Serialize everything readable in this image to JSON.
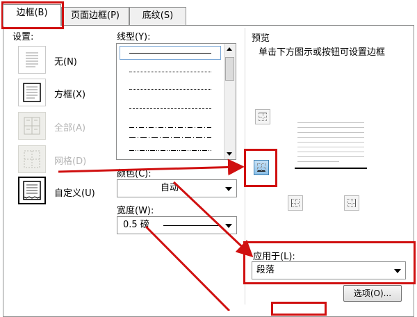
{
  "tabs": [
    {
      "label": "边框(B)"
    },
    {
      "label": "页面边框(P)"
    },
    {
      "label": "底纹(S)"
    }
  ],
  "settings": {
    "title": "设置:",
    "items": [
      {
        "label": "无(N)",
        "enabled": true,
        "selected": false
      },
      {
        "label": "方框(X)",
        "enabled": true,
        "selected": false
      },
      {
        "label": "全部(A)",
        "enabled": false,
        "selected": false
      },
      {
        "label": "网格(D)",
        "enabled": false,
        "selected": false
      },
      {
        "label": "自定义(U)",
        "enabled": true,
        "selected": true
      }
    ]
  },
  "style": {
    "title": "线型(Y):",
    "line_styles": [
      "solid",
      "dotted-fine",
      "dotted",
      "dashed",
      "dash-dot",
      "long-dash-dot",
      "dash-dot-dot"
    ]
  },
  "color": {
    "title": "颜色(C):",
    "value": "自动"
  },
  "width": {
    "title": "宽度(W):",
    "value": "0.5 磅"
  },
  "preview": {
    "title": "预览",
    "hint": "单击下方图示或按钮可设置边框"
  },
  "apply_to": {
    "title": "应用于(L):",
    "value": "段落"
  },
  "options_button": "选项(O)...",
  "colors": {
    "highlight": "#d01010",
    "selected_border_button": "#8cc0e8"
  }
}
